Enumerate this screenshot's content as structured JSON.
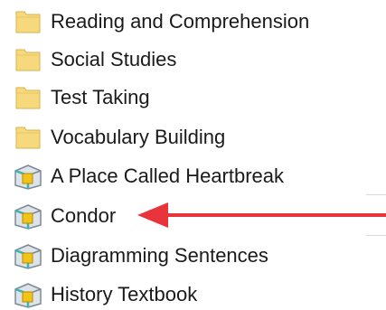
{
  "file_list": {
    "items": [
      {
        "type": "folder",
        "icon": "folder-icon",
        "label": "Reading and Comprehension"
      },
      {
        "type": "folder",
        "icon": "folder-icon",
        "label": "Social Studies"
      },
      {
        "type": "folder",
        "icon": "folder-icon",
        "label": "Test Taking"
      },
      {
        "type": "folder",
        "icon": "folder-icon",
        "label": "Vocabulary Building"
      },
      {
        "type": "shortcut",
        "icon": "book-shortcut-icon",
        "label": "A Place Called Heartbreak"
      },
      {
        "type": "shortcut",
        "icon": "book-shortcut-icon",
        "label": "Condor"
      },
      {
        "type": "shortcut",
        "icon": "book-shortcut-icon",
        "label": "Diagramming Sentences"
      },
      {
        "type": "shortcut",
        "icon": "book-shortcut-icon",
        "label": "History Textbook"
      }
    ]
  },
  "annotation": {
    "arrow_color": "#e8343a",
    "points_to": "Condor"
  },
  "colors": {
    "folder_fill": "#f6d97c",
    "folder_edge": "#d9b24a",
    "shortcut_teal": "#3ab6b0",
    "shortcut_yellow": "#f2c417",
    "shortcut_gray": "#7d8a96"
  }
}
